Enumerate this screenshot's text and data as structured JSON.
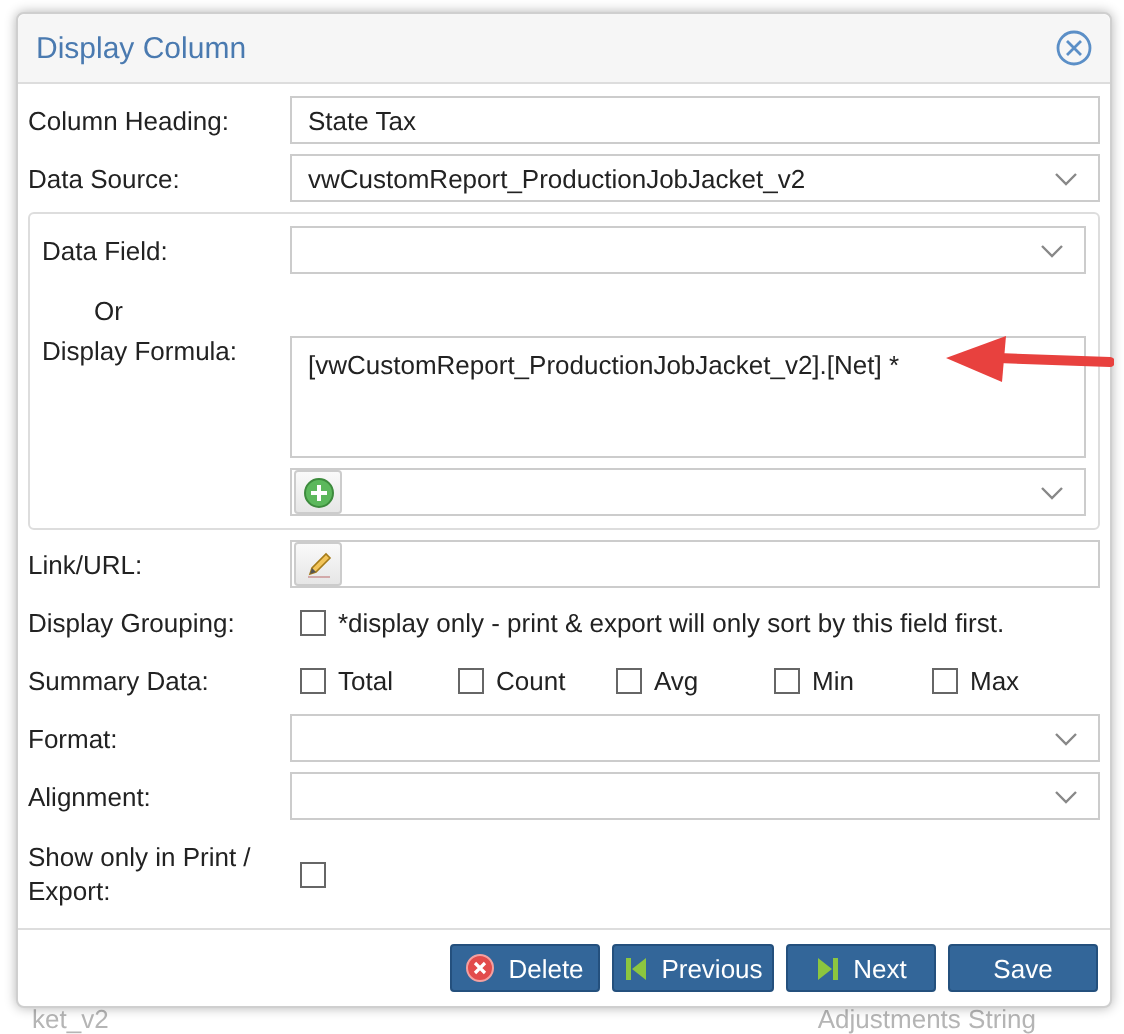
{
  "background_texts": [
    "ket_v2",
    "Adjustments String"
  ],
  "dialog": {
    "title": "Display Column",
    "column_heading": {
      "label": "Column Heading:",
      "value": "State Tax"
    },
    "data_source": {
      "label": "Data Source:",
      "value": "vwCustomReport_ProductionJobJacket_v2"
    },
    "data_field": {
      "label": "Data Field:"
    },
    "or_text": "Or",
    "display_formula": {
      "label": "Display Formula:",
      "value": "[vwCustomReport_ProductionJobJacket_v2].[Net] *"
    },
    "link_url": {
      "label": "Link/URL:"
    },
    "display_grouping": {
      "label": "Display Grouping:",
      "checked": false,
      "note": "*display only - print & export will only sort by this field first."
    },
    "summary_data": {
      "label": "Summary Data:",
      "options": [
        {
          "label": "Total",
          "checked": false
        },
        {
          "label": "Count",
          "checked": false
        },
        {
          "label": "Avg",
          "checked": false
        },
        {
          "label": "Min",
          "checked": false
        },
        {
          "label": "Max",
          "checked": false
        }
      ]
    },
    "format": {
      "label": "Format:"
    },
    "alignment": {
      "label": "Alignment:"
    },
    "show_only_in_print_export": {
      "label": "Show only in Print / Export:",
      "checked": false
    },
    "buttons": [
      {
        "label": "Delete",
        "kind": "delete"
      },
      {
        "label": "Previous",
        "kind": "previous"
      },
      {
        "label": "Next",
        "kind": "next"
      },
      {
        "label": "Save",
        "kind": "save"
      }
    ]
  }
}
